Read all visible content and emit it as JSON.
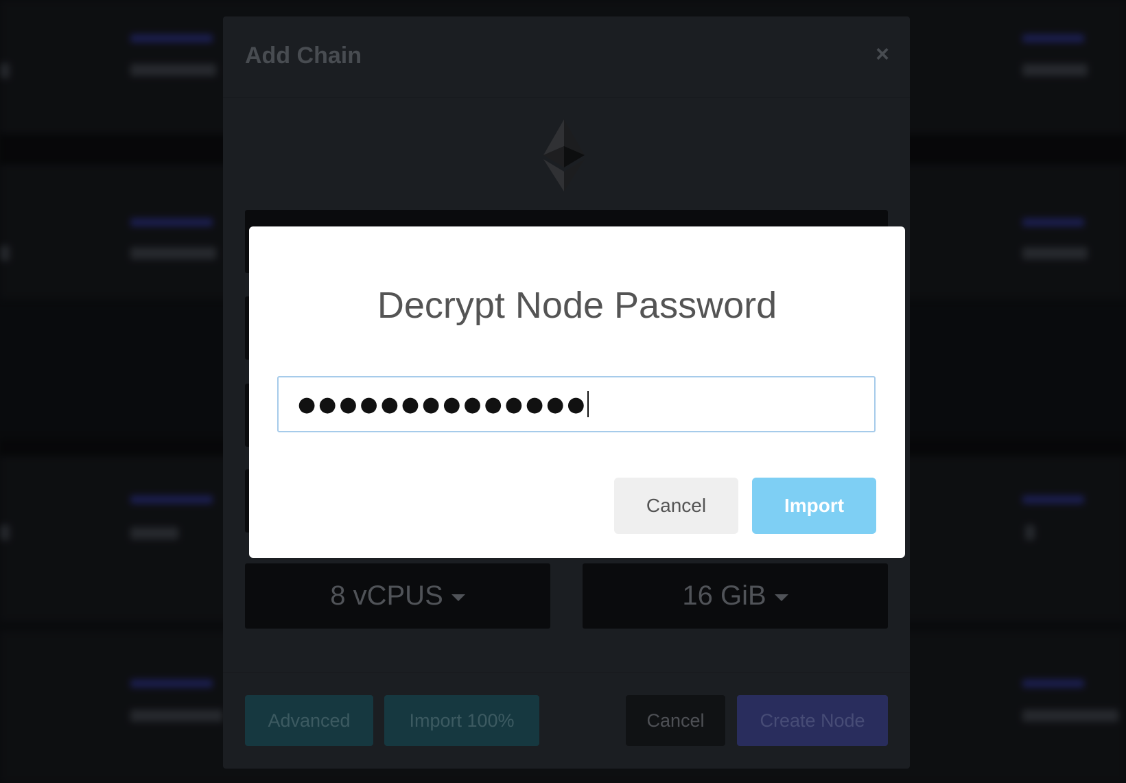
{
  "add_chain_modal": {
    "title": "Add Chain",
    "close_glyph": "×",
    "logo_icon": "ethereum-icon",
    "cpu_dropdown": "8 vCPUS",
    "memory_dropdown": "16 GiB",
    "footer": {
      "advanced": "Advanced",
      "import": "Import 100%",
      "cancel": "Cancel",
      "create": "Create Node"
    }
  },
  "decrypt_dialog": {
    "title": "Decrypt Node Password",
    "password_value": "●●●●●●●●●●●●●●",
    "cancel": "Cancel",
    "import": "Import"
  },
  "colors": {
    "import_button": "#7ecff4",
    "field_focus_border": "#a6cbea",
    "teal_button": "#235663",
    "purple_button": "#3f4690"
  }
}
